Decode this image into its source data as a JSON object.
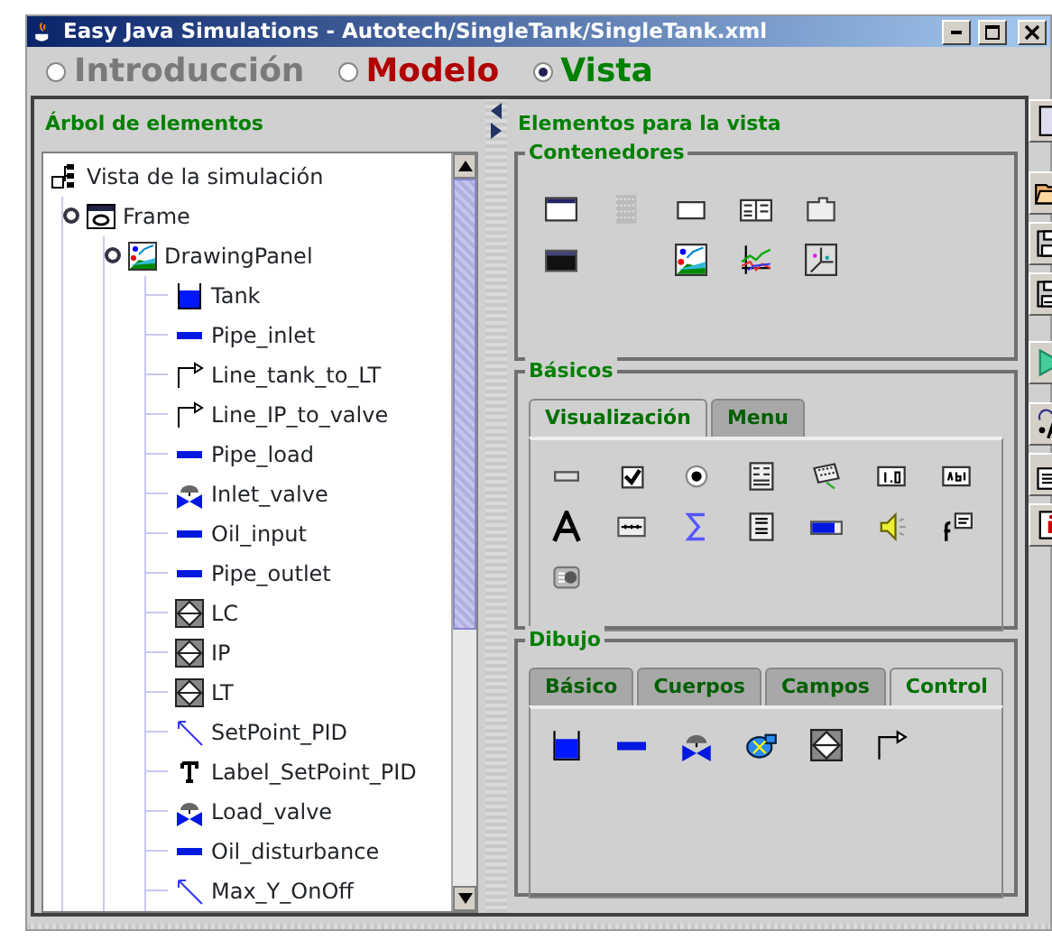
{
  "window": {
    "title": "Easy Java Simulations - Autotech/SingleTank/SingleTank.xml"
  },
  "modes": [
    {
      "label": "Introducción",
      "selected": false,
      "color": "#7a7a7a"
    },
    {
      "label": "Modelo",
      "selected": false,
      "color": "#b00000"
    },
    {
      "label": "Vista",
      "selected": true,
      "color": "#008000"
    }
  ],
  "tree_panel": {
    "title": "Árbol de elementos",
    "tree": [
      {
        "label": "Vista de la simulación",
        "kind": "view",
        "children": [
          {
            "label": "Frame",
            "kind": "frame",
            "expanded": true,
            "children": [
              {
                "label": "DrawingPanel",
                "kind": "panel",
                "expanded": true,
                "children": [
                  {
                    "label": "Tank",
                    "kind": "tank"
                  },
                  {
                    "label": "Pipe_inlet",
                    "kind": "pipe"
                  },
                  {
                    "label": "Line_tank_to_LT",
                    "kind": "line"
                  },
                  {
                    "label": "Line_IP_to_valve",
                    "kind": "line"
                  },
                  {
                    "label": "Pipe_load",
                    "kind": "pipe"
                  },
                  {
                    "label": "Inlet_valve",
                    "kind": "valve"
                  },
                  {
                    "label": "Oil_input",
                    "kind": "pipe"
                  },
                  {
                    "label": "Pipe_outlet",
                    "kind": "pipe"
                  },
                  {
                    "label": "LC",
                    "kind": "display"
                  },
                  {
                    "label": "IP",
                    "kind": "display"
                  },
                  {
                    "label": "LT",
                    "kind": "display"
                  },
                  {
                    "label": "SetPoint_PID",
                    "kind": "arrow"
                  },
                  {
                    "label": "Label_SetPoint_PID",
                    "kind": "text"
                  },
                  {
                    "label": "Load_valve",
                    "kind": "valve"
                  },
                  {
                    "label": "Oil_disturbance",
                    "kind": "pipe"
                  },
                  {
                    "label": "Max_Y_OnOff",
                    "kind": "arrow"
                  }
                ]
              }
            ]
          }
        ]
      }
    ]
  },
  "palette_panel": {
    "title": "Elementos para la vista",
    "groups": [
      {
        "title": "Contenedores"
      },
      {
        "title": "Básicos",
        "tabs": [
          {
            "label": "Visualización",
            "selected": true
          },
          {
            "label": "Menu",
            "selected": false
          }
        ]
      },
      {
        "title": "Dibujo",
        "tabs": [
          {
            "label": "Básico",
            "selected": false
          },
          {
            "label": "Cuerpos",
            "selected": false
          },
          {
            "label": "Campos",
            "selected": false
          },
          {
            "label": "Control",
            "selected": true
          }
        ]
      }
    ]
  }
}
